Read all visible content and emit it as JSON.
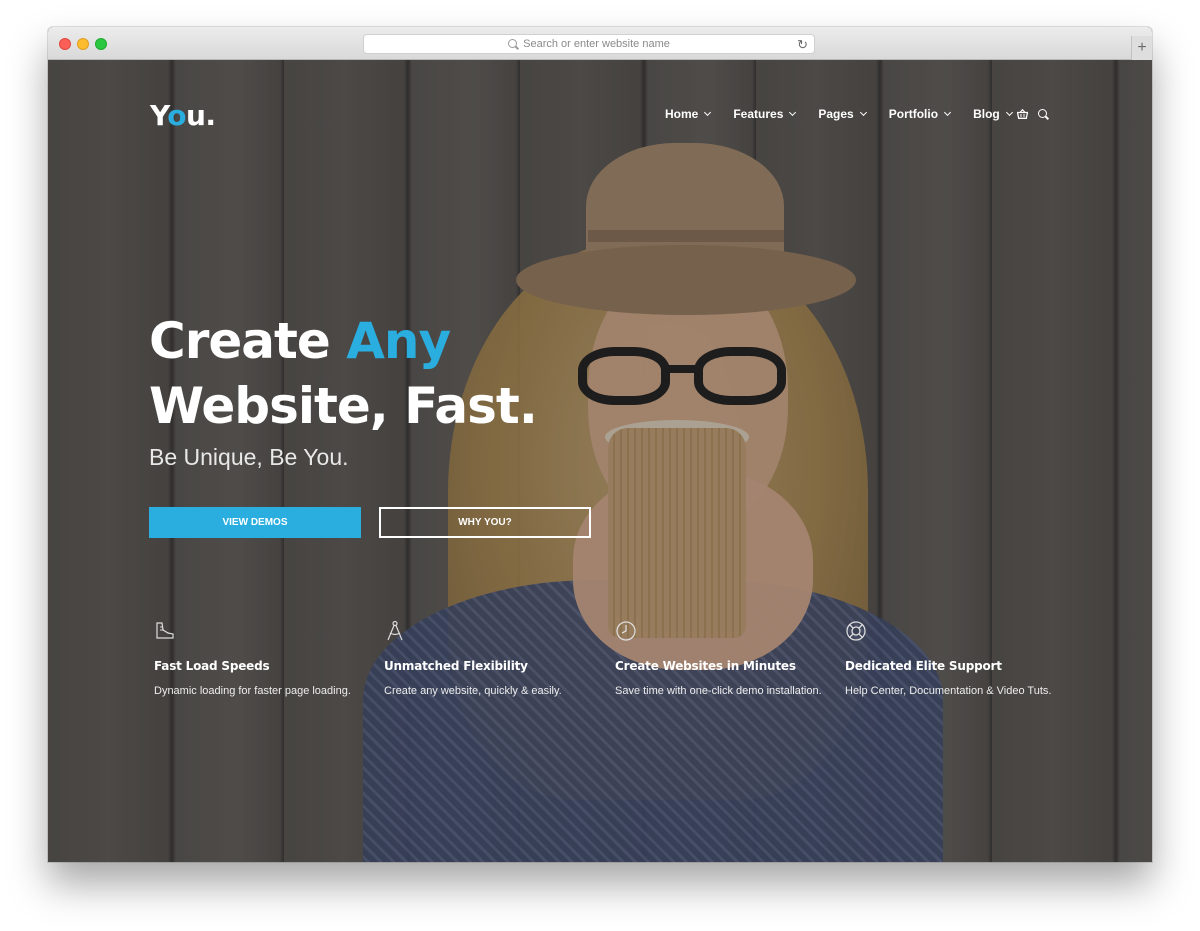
{
  "browser": {
    "url_placeholder": "Search or enter website name",
    "reload_icon": "reload-icon",
    "new_tab_icon": "plus-icon",
    "new_tab_label": "+"
  },
  "site": {
    "logo_prefix": "Y",
    "logo_accent": "o",
    "logo_suffix": "u.",
    "accent_color": "#2aaee0"
  },
  "nav": {
    "items": [
      {
        "label": "Home"
      },
      {
        "label": "Features"
      },
      {
        "label": "Pages"
      },
      {
        "label": "Portfolio"
      },
      {
        "label": "Blog"
      }
    ],
    "cart_icon": "basket-icon",
    "search_icon": "search-icon"
  },
  "hero": {
    "headline_part1": "Create ",
    "headline_accent": "Any",
    "headline_line2": "Website, Fast.",
    "subheadline": "Be Unique, Be You.",
    "primary_button": "VIEW DEMOS",
    "secondary_button": "WHY YOU?"
  },
  "features": [
    {
      "icon": "shoe-icon",
      "title": "Fast Load Speeds",
      "description": "Dynamic loading for faster page loading."
    },
    {
      "icon": "compass-icon",
      "title": "Unmatched Flexibility",
      "description": "Create any website, quickly & easily."
    },
    {
      "icon": "clock-icon",
      "title": "Create Websites in Minutes",
      "description": "Save time with one-click demo installation."
    },
    {
      "icon": "lifebuoy-icon",
      "title": "Dedicated Elite Support",
      "description": "Help Center, Documentation & Video Tuts."
    }
  ]
}
